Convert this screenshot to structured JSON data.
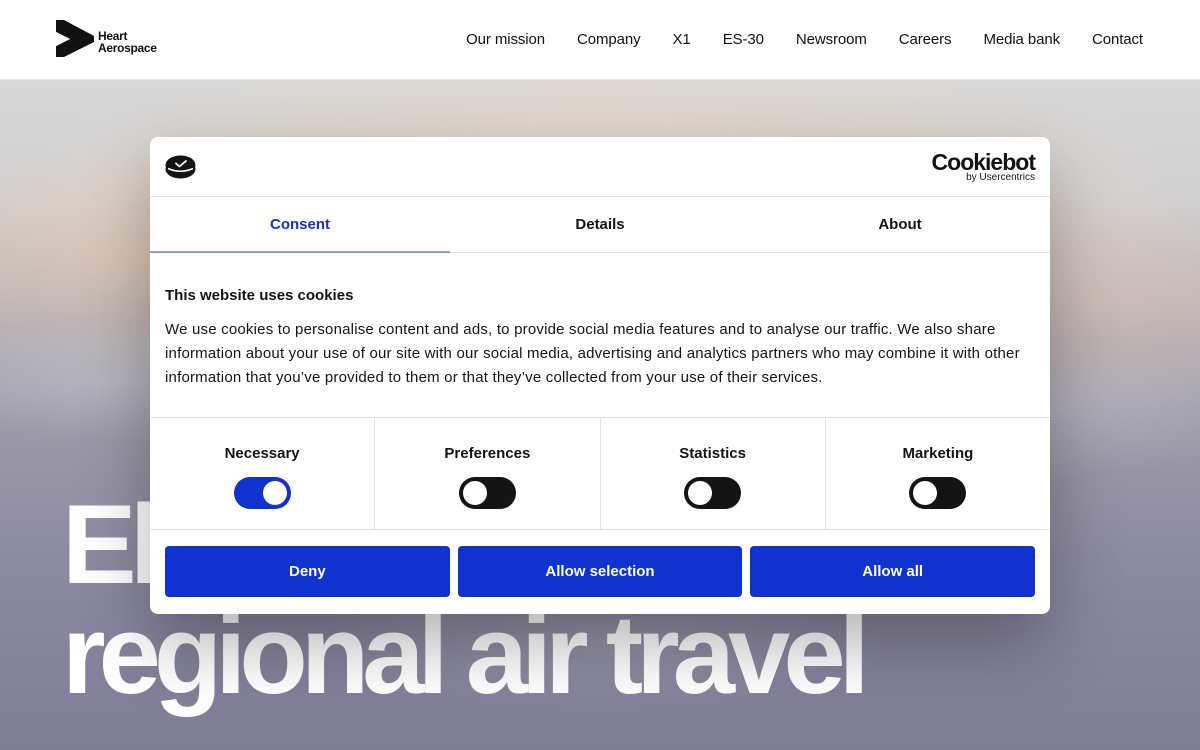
{
  "header": {
    "logo": {
      "line1": "Heart",
      "line2": "Aerospace"
    },
    "nav": [
      "Our mission",
      "Company",
      "X1",
      "ES-30",
      "Newsroom",
      "Careers",
      "Media bank",
      "Contact"
    ]
  },
  "hero": {
    "line1": "El",
    "line2": "regional air travel"
  },
  "dialog": {
    "brand": {
      "name": "Cookiebot",
      "sub": "by Usercentrics"
    },
    "tabs": [
      "Consent",
      "Details",
      "About"
    ],
    "active_tab": "Consent",
    "title": "This website uses cookies",
    "text": "We use cookies to personalise content and ads, to provide social media features and to analyse our traffic. We also share information about your use of our site with our social media, advertising and analytics partners who may combine it with other information that you’ve provided to them or that they’ve collected from your use of their services.",
    "toggles": [
      {
        "label": "Necessary",
        "on": true
      },
      {
        "label": "Preferences",
        "on": false
      },
      {
        "label": "Statistics",
        "on": false
      },
      {
        "label": "Marketing",
        "on": false
      }
    ],
    "buttons": {
      "deny": "Deny",
      "selection": "Allow selection",
      "all": "Allow all"
    }
  },
  "colors": {
    "accent": "#1032cf",
    "text": "#141414",
    "switch_off": "#141414"
  }
}
